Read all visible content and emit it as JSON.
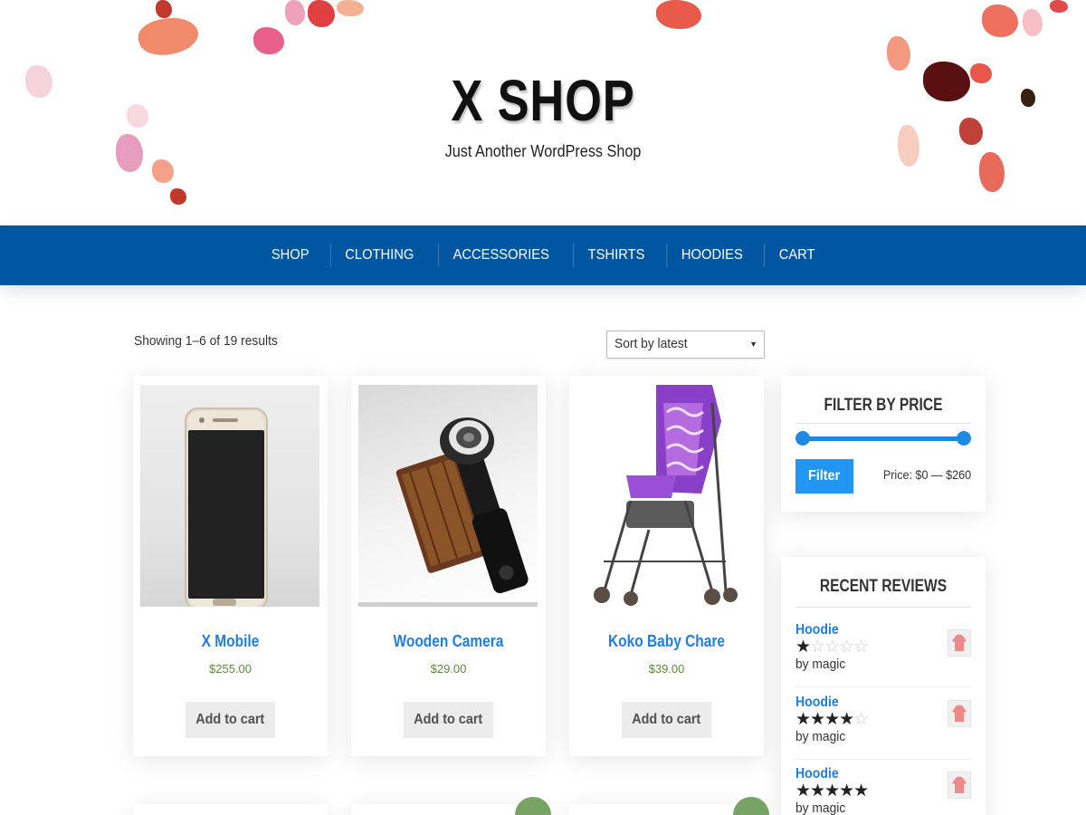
{
  "site": {
    "title": "X SHOP",
    "tagline": "Just Another WordPress Shop"
  },
  "nav": {
    "items": [
      "SHOP",
      "CLOTHING",
      "ACCESSORIES",
      "TSHIRTS",
      "HOODIES",
      "CART"
    ]
  },
  "shop": {
    "result_count": "Showing 1–6 of 19 results",
    "sort": {
      "selected": "Sort by latest"
    }
  },
  "products": [
    {
      "title": "X Mobile",
      "price": "$255.00",
      "button": "Add to cart",
      "image_icon": "phone-image"
    },
    {
      "title": "Wooden Camera",
      "price": "$29.00",
      "button": "Add to cart",
      "image_icon": "camera-image"
    },
    {
      "title": "Koko Baby Chare",
      "price": "$39.00",
      "button": "Add to cart",
      "image_icon": "stroller-image"
    }
  ],
  "filter": {
    "title": "FILTER BY PRICE",
    "button": "Filter",
    "price_label": "Price: $0 — $260",
    "range": [
      0,
      260
    ]
  },
  "reviews": {
    "title": "RECENT REVIEWS",
    "items": [
      {
        "product": "Hoodie",
        "rating": 1,
        "by": "by magic"
      },
      {
        "product": "Hoodie",
        "rating": 4,
        "by": "by magic"
      },
      {
        "product": "Hoodie",
        "rating": 5,
        "by": "by magic"
      }
    ]
  },
  "colors": {
    "nav_bg": "#0056a0",
    "link": "#1e7fe0",
    "price": "#5b8a3a",
    "filter_accent": "#2196f3",
    "sale_badge": "#77a464"
  }
}
